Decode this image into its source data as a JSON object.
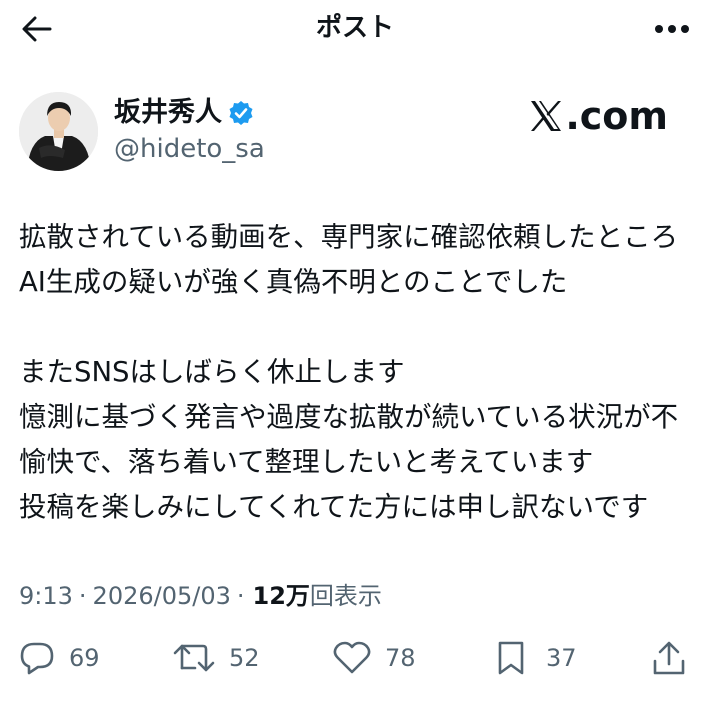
{
  "header": {
    "title": "ポスト",
    "back_icon": "back-arrow-icon",
    "more_icon": "more-horizontal-icon"
  },
  "author": {
    "display_name": "坂井秀人",
    "handle": "@hideto_sa",
    "verified": true,
    "verified_color": "#1d9bf0"
  },
  "brand": {
    "text": ".com"
  },
  "tweet": {
    "text": "拡散されている動画を、専門家に確認依頼したところAI生成の疑いが強く真偽不明とのことでした\n\nまたSNSはしばらく休止します\n憶測に基づく発言や過度な拡散が続いている状況が不愉快で、落ち着いて整理したいと考えています\n投稿を楽しみにしてくれてた方には申し訳ないです"
  },
  "meta": {
    "time": "9:13",
    "separator": "·",
    "date": "2026/05/03",
    "views_count": "12万",
    "views_label": "回表示"
  },
  "actions": {
    "reply_count": "69",
    "repost_count": "52",
    "like_count": "78",
    "bookmark_count": "37"
  },
  "colors": {
    "text": "#0f1419",
    "secondary": "#536471",
    "accent": "#1d9bf0"
  }
}
